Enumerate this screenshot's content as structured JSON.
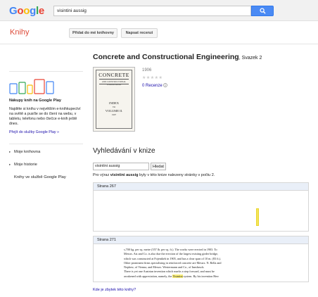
{
  "header": {
    "logo_letters": [
      "G",
      "o",
      "o",
      "g",
      "l",
      "e"
    ],
    "logo_colors": [
      "#4285f4",
      "#ea4335",
      "#fbbc05",
      "#4285f4",
      "#34a853",
      "#ea4335"
    ],
    "search_value": "visintini aussig",
    "search_button_icon": "search-icon"
  },
  "subheader": {
    "product": "Knihy",
    "add_to_library": "Přidat do mé knihovny",
    "write_review": "Napsat recenzi"
  },
  "book": {
    "title": "Concrete and Constructional Engineering",
    "volume": ", Svazek 2",
    "year": "1906",
    "stars": "★★★★★",
    "reviews": "0 Recenze",
    "reviews_icon": "info-icon",
    "cover": {
      "title": "CONCRETE",
      "subtitle": "AND CONSTRUCTIONAL ENGINEERING",
      "index": "INDEX",
      "to": "TO",
      "volume": "VOLUME II.",
      "year": "1907"
    }
  },
  "sidebar": {
    "play_title": "Nákupy knih na Google Play",
    "play_desc": "Najděte si knihu v největším e-knihkupectví na světě a pusťte se do čtení na webu, v tabletu, telefonu nebo čtečce e-knih ještě dnes.",
    "play_link": "Přejít do služby Google Play »",
    "nav": [
      {
        "label": "Moje knihovna",
        "arrow": "▸"
      },
      {
        "label": "Moje historie",
        "arrow": "▸"
      },
      {
        "label": "Knihy ve službě Google Play",
        "arrow": ""
      }
    ]
  },
  "search_in_book": {
    "heading": "Vyhledávání v knize",
    "input_value": "visintini aussig",
    "button": "Hledat",
    "result_prefix": "Pro výraz ",
    "result_term": "visintini aussig",
    "result_suffix": " byly v této knize nalezeny stránky v počtu 2."
  },
  "results": [
    {
      "label": "Strana 267"
    },
    {
      "label": "Strana 271"
    }
  ],
  "snippet": {
    "lines": [
      "s,700 kg. per sq. metre (557 lb. per sq. ft.). The works were erected in 1903. To",
      "Messrs. Ast and Co. is also due the erection of the largest existing girder bridge,",
      "which was constructed at Fojentkeh in 1905, and has a clear span of 10 m. (83 ft.).",
      "Other prominent firms specialising in reinforced concrete are Messrs. N. Rella and",
      "Nephew, of Vienna, and Messrs. Westermann and Co., of Innsbruck.",
      "There is yet one Austrian invention which marks a step forward, and must be",
      "awakened with appreciation, namely, the "
    ],
    "highlight": "Visintini",
    "tail": " system. By his invention Herr"
  },
  "more_link": "Kde je zbytek této knihy?"
}
